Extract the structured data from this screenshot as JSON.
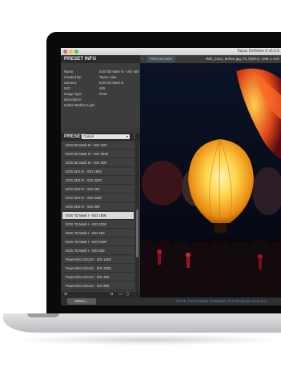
{
  "window": {
    "title": "Topaz DeNoise 6 v6.0.0"
  },
  "preset_info": {
    "header": "PRESET INFO",
    "rows": [
      {
        "key": "Name:",
        "value": "EOS 5D Mark III - ISO 400"
      },
      {
        "key": "Created By:",
        "value": "Topaz Labs"
      },
      {
        "key": "Camera:",
        "value": "EOS 5D Mark III"
      },
      {
        "key": "ISO:",
        "value": "400"
      },
      {
        "key": "Image Type:",
        "value": "RAW"
      },
      {
        "key": "Description:",
        "value": ""
      },
      {
        "key": "Indoor Medium Light",
        "value": ""
      }
    ]
  },
  "presets": {
    "label": "PRESETS",
    "dropdown_value": "Canon",
    "items": [
      "EOS 5D Mark III - ISO 400",
      "EOS 5D Mark III - ISO 6400",
      "EOS 5D Mark III - ISO 800",
      "EOS 5DS R - ISO 1600",
      "EOS 5DS R - ISO 3200",
      "EOS 5DS R - ISO 400",
      "EOS 5DS R - ISO 6400",
      "EOS 5DS R - ISO 800",
      "EOS 7D Mark I - ISO 1600",
      "EOS 7D Mark I - ISO 3200",
      "EOS 7D Mark I - ISO 400",
      "EOS 7D Mark I - ISO 6400",
      "EOS 7D Mark I - ISO 800",
      "PowerShot SX110 - ISO 1600",
      "PowerShot SX110 - ISO 3200",
      "PowerShot SX110 - ISO 400",
      "PowerShot SX110 - ISO 800"
    ],
    "selected_index": 8
  },
  "view": {
    "tab_label": "PROCESSED",
    "filename": "IMG_2121_before.jpg, f/1.7(82%), 1/98 s, ISO"
  },
  "bottom": {
    "button_label": "MENU...",
    "note": "NOTE: For accurate evaluation of result please view at a"
  },
  "colors": {
    "accent": "#6fa8dc",
    "selected": "#d9d9d9",
    "panel": "#3a3a3a"
  }
}
